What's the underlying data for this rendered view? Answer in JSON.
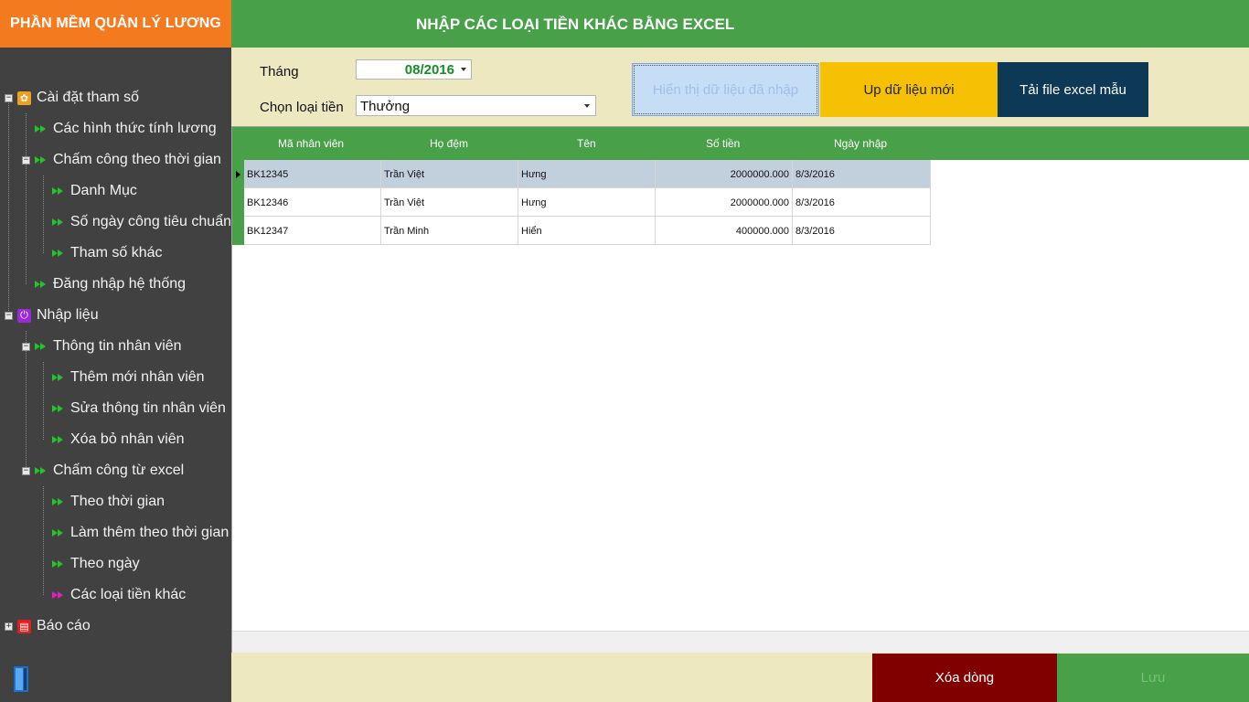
{
  "app": {
    "title": "PHẦN MỀM QUẢN LÝ LƯƠNG"
  },
  "header": {
    "title": "NHẬP CÁC LOẠI TIỀN KHÁC BẰNG EXCEL"
  },
  "sidebar": {
    "items": [
      {
        "label": "Cài đặt tham số",
        "level": 0,
        "icon": "gear-icon",
        "color": "#f0a020"
      },
      {
        "label": "Các hình thức tính lương",
        "level": 1,
        "icon": "double-arrow-icon"
      },
      {
        "label": "Chấm công theo thời gian",
        "level": 1,
        "icon": "double-arrow-icon"
      },
      {
        "label": "Danh Mục",
        "level": 2,
        "icon": "double-arrow-icon"
      },
      {
        "label": "Số ngày công tiêu chuẩn",
        "level": 2,
        "icon": "double-arrow-icon"
      },
      {
        "label": "Tham số khác",
        "level": 2,
        "icon": "double-arrow-icon"
      },
      {
        "label": "Đăng nhập hệ thống",
        "level": 1,
        "icon": "double-arrow-icon"
      },
      {
        "label": "Nhập liệu",
        "level": 0,
        "icon": "import-icon",
        "color": "#9b2bd6"
      },
      {
        "label": "Thông tin nhân viên",
        "level": 1,
        "icon": "double-arrow-icon"
      },
      {
        "label": "Thêm mới nhân viên",
        "level": 2,
        "icon": "double-arrow-icon"
      },
      {
        "label": "Sửa thông tin nhân viên",
        "level": 2,
        "icon": "double-arrow-icon"
      },
      {
        "label": "Xóa bỏ nhân viên",
        "level": 2,
        "icon": "double-arrow-icon"
      },
      {
        "label": "Chấm công từ excel",
        "level": 1,
        "icon": "double-arrow-icon"
      },
      {
        "label": "Theo thời gian",
        "level": 2,
        "icon": "double-arrow-icon"
      },
      {
        "label": "Làm thêm theo thời gian",
        "level": 2,
        "icon": "double-arrow-icon"
      },
      {
        "label": "Theo ngày",
        "level": 2,
        "icon": "double-arrow-icon"
      },
      {
        "label": "Các loại tiền khác",
        "level": 2,
        "icon": "double-arrow-icon-active"
      },
      {
        "label": "Báo cáo",
        "level": 0,
        "icon": "report-icon",
        "color": "#e02020"
      }
    ]
  },
  "filters": {
    "month_label": "Tháng",
    "month_value": "08/2016",
    "type_label": "Chọn loại tiền",
    "type_value": "Thưởng"
  },
  "actions": {
    "show_label": "Hiển thị dữ liệu đã nhập",
    "upload_label": "Up dữ liệu mới",
    "download_label": "Tải file excel mẫu",
    "delete_label": "Xóa dòng",
    "save_label": "Lưu"
  },
  "grid": {
    "columns": [
      "Mã nhân viên",
      "Họ đệm",
      "Tên",
      "Số tiền",
      "Ngày nhập"
    ],
    "rows": [
      [
        "BK12345",
        "Trần Việt",
        "Hưng",
        "2000000.000",
        "8/3/2016"
      ],
      [
        "BK12346",
        "Trần Việt",
        "Hưng",
        "2000000.000",
        "8/3/2016"
      ],
      [
        "BK12347",
        "Trần Minh",
        "Hiển",
        "400000.000",
        "8/3/2016"
      ]
    ]
  },
  "colors": {
    "accent_green": "#48a048",
    "title_orange": "#f47a20",
    "upload_yellow": "#f6c105",
    "download_navy": "#0d3957",
    "delete_maroon": "#800000"
  }
}
